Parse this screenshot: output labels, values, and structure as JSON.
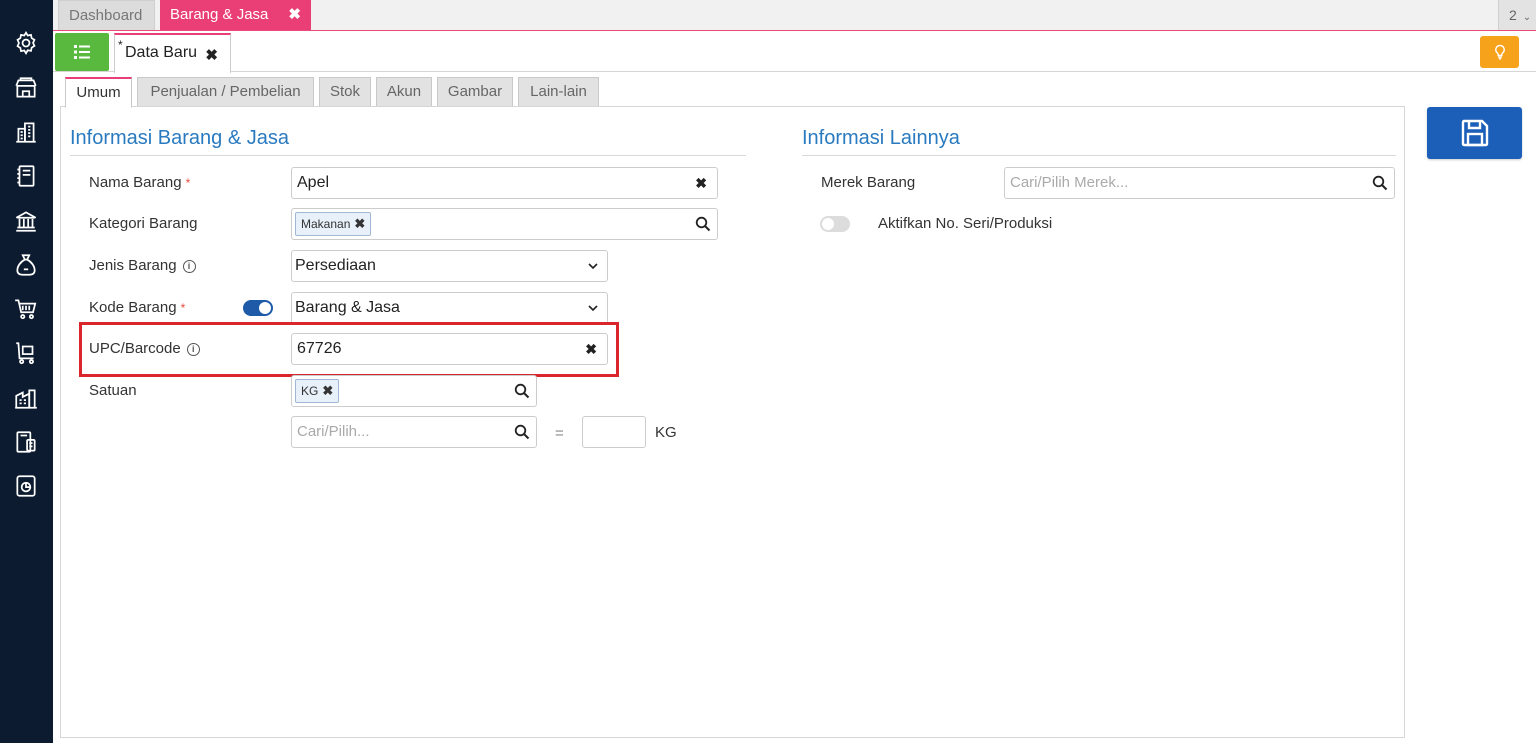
{
  "sidebar": {
    "icons": [
      "settings-icon",
      "store-icon",
      "company-icon",
      "ledger-icon",
      "bank-icon",
      "money-bag-icon",
      "cart-icon",
      "shipping-cart-icon",
      "warehouse-icon",
      "tax-icon",
      "report-icon"
    ]
  },
  "top_tabs": {
    "dashboard": "Dashboard",
    "active": "Barang & Jasa",
    "close_glyph": "✖",
    "window_count": "2",
    "window_chevron": "⌄"
  },
  "doc_tab": {
    "modified_marker": "*",
    "label": "Data Baru",
    "close_glyph": "✖"
  },
  "section_tabs": [
    "Umum",
    "Penjualan / Pembelian",
    "Stok",
    "Akun",
    "Gambar",
    "Lain-lain"
  ],
  "left_section": {
    "title": "Informasi Barang & Jasa",
    "nama_barang": {
      "label": "Nama Barang",
      "required": "*",
      "value": "Apel",
      "clear_glyph": "✖"
    },
    "kategori_barang": {
      "label": "Kategori Barang",
      "chip": "Makanan",
      "chip_remove": "✖"
    },
    "jenis_barang": {
      "label": "Jenis Barang",
      "info": "i",
      "value": "Persediaan"
    },
    "kode_barang": {
      "label": "Kode Barang",
      "required": "*",
      "toggle_on": true,
      "value": "Barang & Jasa"
    },
    "upc_barcode": {
      "label": "UPC/Barcode",
      "info": "i",
      "value": "67726",
      "clear_glyph": "✖"
    },
    "satuan": {
      "label": "Satuan",
      "chip": "KG",
      "chip_remove": "✖",
      "placeholder": "Cari/Pilih...",
      "equals": "=",
      "unit": "KG"
    }
  },
  "right_section": {
    "title": "Informasi Lainnya",
    "merek_barang": {
      "label": "Merek Barang",
      "placeholder": "Cari/Pilih Merek..."
    },
    "seri_produksi": {
      "label": "Aktifkan No. Seri/Produksi",
      "toggle_on": false
    }
  },
  "colors": {
    "sidebar": "#0d1b30",
    "accent_pink": "#ea3f76",
    "green": "#58b93e",
    "orange": "#f7a21b",
    "blue": "#1c5fb8",
    "section_title": "#2a7ac0",
    "highlight": "#d9262c"
  }
}
